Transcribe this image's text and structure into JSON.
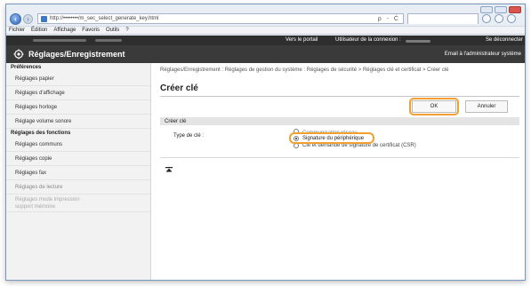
{
  "browser": {
    "url": "http://••••••••/m_sec_select_generate_key.html",
    "url_tools": "ρ - Ċ",
    "menu": [
      "Fichier",
      "Édition",
      "Affichage",
      "Favoris",
      "Outils",
      "?"
    ]
  },
  "header": {
    "portal_link": "Vers le portail",
    "user_label": "Utilisateur de la connexion :",
    "logout": "Se déconnecter",
    "brand": "Réglages/Enregistrement",
    "email_admin": "Email à l'administrateur système"
  },
  "sidebar": {
    "section1": "Préférences",
    "items1": [
      "Réglages papier",
      "Réglages d'affichage",
      "Réglages horloge",
      "Réglage volume sonore"
    ],
    "section2": "Réglages des fonctions",
    "items2": [
      "Réglages communs",
      "Réglages copie",
      "Réglages fax",
      "Réglages de lecture"
    ],
    "item_last_line1": "Réglages mode impression",
    "item_last_line2": "support mémoire"
  },
  "main": {
    "breadcrumb": "Réglages/Enregistrement : Réglages de gestion du système : Réglages de sécurité > Réglages clé et certificat > Créer clé",
    "title": "Créer clé",
    "ok": "OK",
    "cancel": "Annuler",
    "panel_title": "Créer clé",
    "key_type_label": "Type de clé :",
    "options": [
      "Communication réseau",
      "Signature du périphérique",
      "Clé et demande de signature de certificat (CSR)"
    ],
    "selected_option": "Signature du périphérique"
  },
  "colors": {
    "highlight": "#f0a030",
    "banner": "#3a3a3a"
  }
}
